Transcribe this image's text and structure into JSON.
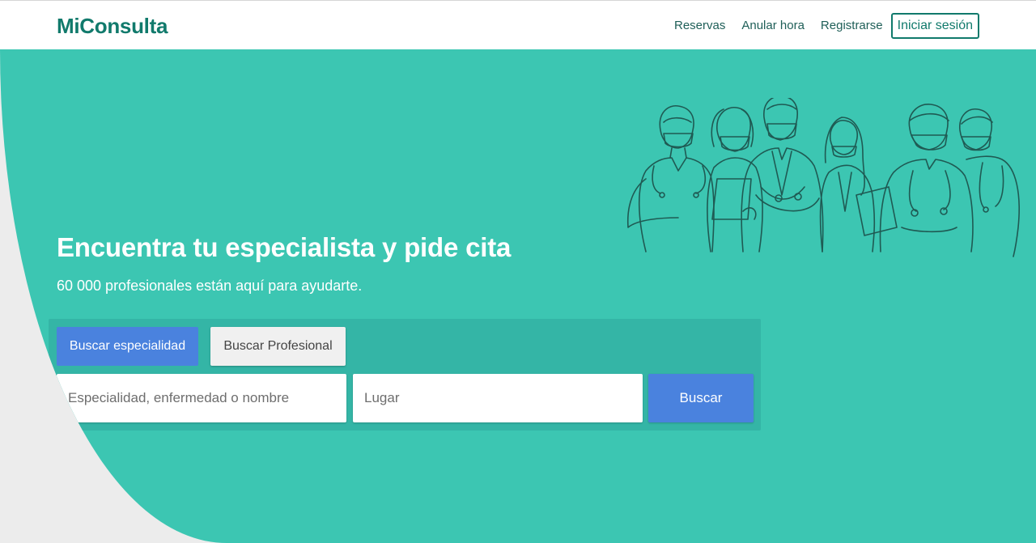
{
  "header": {
    "brand": "MiConsulta",
    "nav": [
      {
        "label": "Reservas"
      },
      {
        "label": "Anular hora"
      },
      {
        "label": "Registrarse"
      }
    ],
    "login_label": "Iniciar sesión"
  },
  "hero": {
    "title": "Encuentra tu especialista y pide cita",
    "subtitle": "60 000 profesionales están aquí para ayudarte.",
    "illustration": "medical-staff-illustration"
  },
  "search": {
    "tab_specialty": "Buscar especialidad",
    "tab_professional": "Buscar Profesional",
    "active_tab": "Buscar especialidad",
    "query_placeholder": "Especialidad, enfermedad o nombre",
    "query_value": "",
    "location_placeholder": "Lugar",
    "location_value": "",
    "submit_label": "Buscar"
  },
  "colors": {
    "brand": "#117a6c",
    "hero_bg": "#3cc6b2",
    "panel_bg": "#34b5a6",
    "accent_button": "#4a82de",
    "page_bg": "#ececec"
  }
}
